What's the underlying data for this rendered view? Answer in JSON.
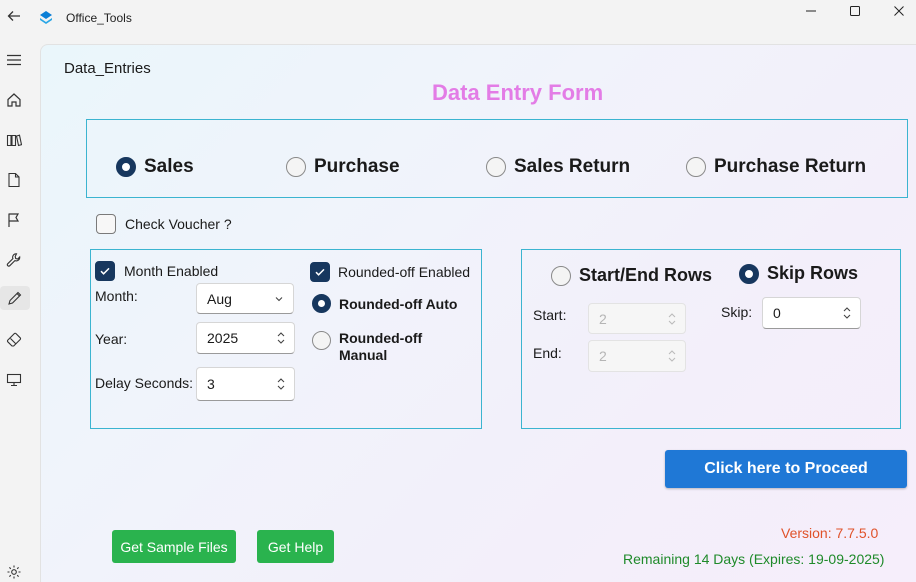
{
  "window": {
    "title": "Office_Tools",
    "controls": [
      "minimize",
      "maximize",
      "close"
    ]
  },
  "sidebar": {
    "items": [
      {
        "name": "menu",
        "icon": "hamburger-icon"
      },
      {
        "name": "home",
        "icon": "home-icon"
      },
      {
        "name": "library",
        "icon": "book-icon"
      },
      {
        "name": "document",
        "icon": "document-icon"
      },
      {
        "name": "flag",
        "icon": "flag-icon"
      },
      {
        "name": "tools",
        "icon": "wrench-icon"
      },
      {
        "name": "edit",
        "icon": "pen-icon"
      },
      {
        "name": "eraser",
        "icon": "eraser-icon"
      },
      {
        "name": "desktop",
        "icon": "monitor-icon"
      },
      {
        "name": "settings",
        "icon": "gear-icon"
      }
    ],
    "active": "edit"
  },
  "page": {
    "title": "Data_Entries",
    "heading": "Data Entry Form",
    "heading_color": "#e37ce6"
  },
  "voucher_type": {
    "options": [
      "Sales",
      "Purchase",
      "Sales Return",
      "Purchase Return"
    ],
    "selected": "Sales"
  },
  "check_voucher": {
    "label": "Check Voucher ?",
    "checked": false
  },
  "left_panel": {
    "month_enabled": {
      "label": "Month Enabled",
      "checked": true
    },
    "month": {
      "label": "Month:",
      "value": "Aug"
    },
    "year": {
      "label": "Year:",
      "value": "2025"
    },
    "delay": {
      "label": "Delay Seconds:",
      "value": "3"
    },
    "rounded_enabled": {
      "label": "Rounded-off Enabled",
      "checked": true
    },
    "rounded_auto": {
      "label": "Rounded-off Auto",
      "selected": true
    },
    "rounded_manual": {
      "label": "Rounded-off Manual",
      "selected": false
    }
  },
  "right_panel": {
    "start_end_rows": {
      "label": "Start/End Rows",
      "selected": false
    },
    "skip_rows": {
      "label": "Skip Rows",
      "selected": true
    },
    "start": {
      "label": "Start:",
      "value": "2",
      "disabled": true
    },
    "end": {
      "label": "End:",
      "value": "2",
      "disabled": true
    },
    "skip": {
      "label": "Skip:",
      "value": "0"
    }
  },
  "actions": {
    "proceed": "Click here to Proceed",
    "sample_files": "Get Sample Files",
    "help": "Get Help"
  },
  "footer": {
    "version": "Version: 7.7.5.0",
    "remaining": "Remaining 14 Days (Expires: 19-09-2025)"
  },
  "colors": {
    "accent": "#17375e",
    "border": "#3bb4d0",
    "proceed": "#1f78d6",
    "green": "#2ab34e",
    "version": "#e0522a",
    "remaining": "#1f8a2a"
  }
}
